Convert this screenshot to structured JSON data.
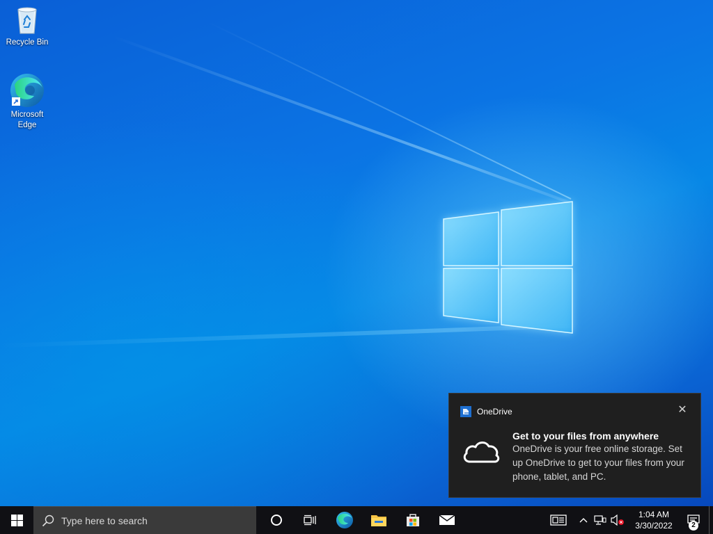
{
  "desktop": {
    "icons": [
      {
        "label": "Recycle Bin",
        "icon": "recycle-bin-icon"
      },
      {
        "label": "Microsoft\nEdge",
        "label_line1": "Microsoft",
        "label_line2": "Edge",
        "icon": "edge-icon"
      }
    ]
  },
  "toast": {
    "app_name": "OneDrive",
    "title": "Get to your files from anywhere",
    "body": "OneDrive is your free online storage. Set up OneDrive to get to your files from your phone, tablet, and PC.",
    "close_icon": "close-icon",
    "hero_icon": "cloud-icon"
  },
  "taskbar": {
    "search_placeholder": "Type here to search",
    "pinned": [
      "cortana-icon",
      "task-view-icon",
      "edge-icon",
      "file-explorer-icon",
      "microsoft-store-icon",
      "mail-icon"
    ],
    "tray": {
      "icons": [
        "news-icon",
        "chevron-up-icon",
        "network-icon",
        "volume-muted-icon"
      ],
      "time": "1:04 AM",
      "date": "3/30/2022",
      "notification_count": "2"
    }
  },
  "colors": {
    "taskbar": "#101014",
    "search_box": "#3a3a3a",
    "toast_bg": "#1f1f1f",
    "desktop_blue": "#0b74e4"
  }
}
